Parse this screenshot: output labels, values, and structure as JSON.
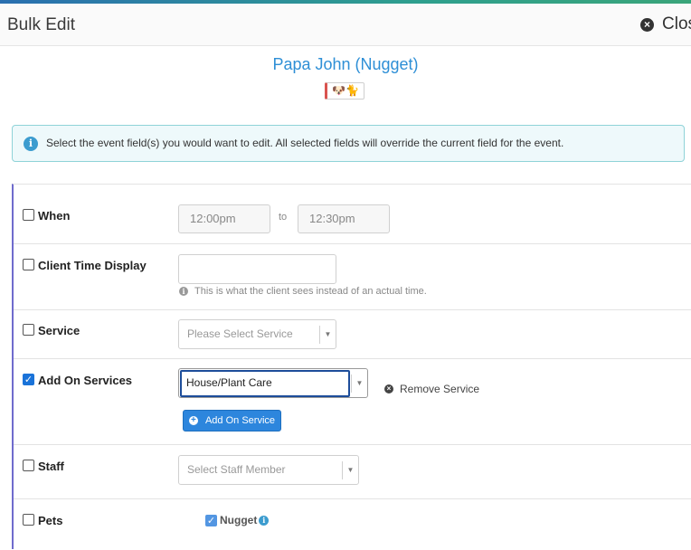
{
  "header": {
    "title": "Bulk Edit",
    "close_label": "Clos"
  },
  "client": {
    "name": "Papa John (Nugget)",
    "pet_badge": "🐶🐈"
  },
  "info": {
    "message": "Select the event field(s) you would want to edit. All selected fields will override the current field for the event."
  },
  "fields": {
    "when": {
      "label": "When",
      "checked": false,
      "start_time": "12:00pm",
      "to_text": "to",
      "end_time": "12:30pm"
    },
    "client_time_display": {
      "label": "Client Time Display",
      "checked": false,
      "value": "",
      "help": "This is what the client sees instead of an actual time."
    },
    "service": {
      "label": "Service",
      "checked": false,
      "placeholder": "Please Select Service"
    },
    "add_on_services": {
      "label": "Add On Services",
      "checked": true,
      "selected": "House/Plant Care",
      "remove_label": "Remove Service",
      "add_button": "Add On Service"
    },
    "staff": {
      "label": "Staff",
      "checked": false,
      "placeholder": "Select Staff Member"
    },
    "pets": {
      "label": "Pets",
      "checked": false,
      "pet_name": "Nugget",
      "pet_checked": true
    }
  },
  "colors": {
    "accent": "#2e8fd6",
    "button": "#2d86dd",
    "info_bg": "#eef9fb",
    "form_border": "#6f6bcd"
  }
}
